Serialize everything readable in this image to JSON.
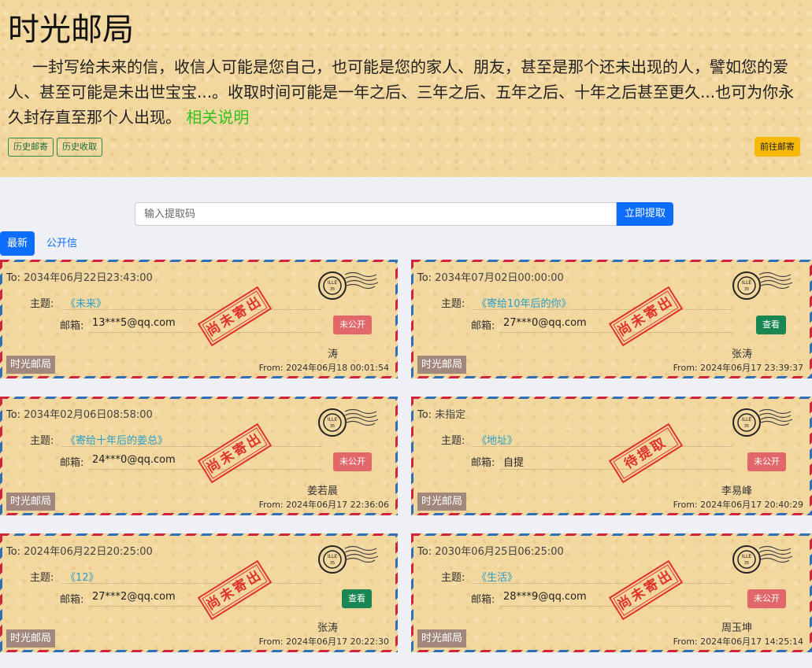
{
  "header": {
    "title": "时光邮局",
    "description": "一封写给未来的信，收信人可能是您自己，也可能是您的家人、朋友，甚至是那个还未出现的人，譬如您的爱人、甚至可能是未出世宝宝...。收取时间可能是一年之后、三年之后、五年之后、十年之后甚至更久...也可为你永久封存直至那个人出现。",
    "link": "相关说明",
    "history_send": "历史邮寄",
    "history_receive": "历史收取",
    "go_send": "前往邮寄"
  },
  "search": {
    "placeholder": "输入提取码",
    "button": "立即提取"
  },
  "tabs": [
    "最新",
    "公开信"
  ],
  "letters": [
    {
      "to_label": "To:",
      "to": "2034年06月22日23:43:00",
      "subject_label": "主题:",
      "subject": "《未来》",
      "email_label": "邮箱:",
      "email": "13***5@qq.com",
      "stamp": "尚未寄出",
      "status": "未公开",
      "sender": "涛",
      "from": "From: 2024年06月18 00:01:54",
      "brand": "时光邮局"
    },
    {
      "to_label": "To:",
      "to": "2034年07月02日00:00:00",
      "subject_label": "主题:",
      "subject": "《寄给10年后的你》",
      "email_label": "邮箱:",
      "email": "27***0@qq.com",
      "stamp": "尚未寄出",
      "status": "查看",
      "sender": "张涛",
      "from": "From: 2024年06月17 23:39:37",
      "brand": "时光邮局"
    },
    {
      "to_label": "To:",
      "to": "2034年02月06日08:58:00",
      "subject_label": "主题:",
      "subject": "《寄给十年后的姜总》",
      "email_label": "邮箱:",
      "email": "24***0@qq.com",
      "stamp": "尚未寄出",
      "status": "未公开",
      "sender": "姜若晨",
      "from": "From: 2024年06月17 22:36:06",
      "brand": "时光邮局"
    },
    {
      "to_label": "To:",
      "to": "未指定",
      "subject_label": "主题:",
      "subject": "《地址》",
      "email_label": "邮箱:",
      "email": "自提",
      "stamp": "待提取",
      "status": "未公开",
      "sender": "李易峰",
      "from": "From: 2024年06月17 20:40:29",
      "brand": "时光邮局"
    },
    {
      "to_label": "To:",
      "to": "2024年06月22日20:25:00",
      "subject_label": "主题:",
      "subject": "《12》",
      "email_label": "邮箱:",
      "email": "27***2@qq.com",
      "stamp": "尚未寄出",
      "status": "查看",
      "sender": "张涛",
      "from": "From: 2024年06月17 20:22:30",
      "brand": "时光邮局"
    },
    {
      "to_label": "To:",
      "to": "2030年06月25日06:25:00",
      "subject_label": "主题:",
      "subject": "《生活》",
      "email_label": "邮箱:",
      "email": "28***9@qq.com",
      "stamp": "尚未寄出",
      "status": "未公开",
      "sender": "周玉坤",
      "from": "From: 2024年06月17 14:25:14",
      "brand": "时光邮局"
    }
  ],
  "colors": {
    "paper": "#f2d79f",
    "primary": "#0d6efd",
    "warning": "#f7b909",
    "success": "#198754",
    "danger": "#e2676b",
    "stamp": "#e02020"
  }
}
